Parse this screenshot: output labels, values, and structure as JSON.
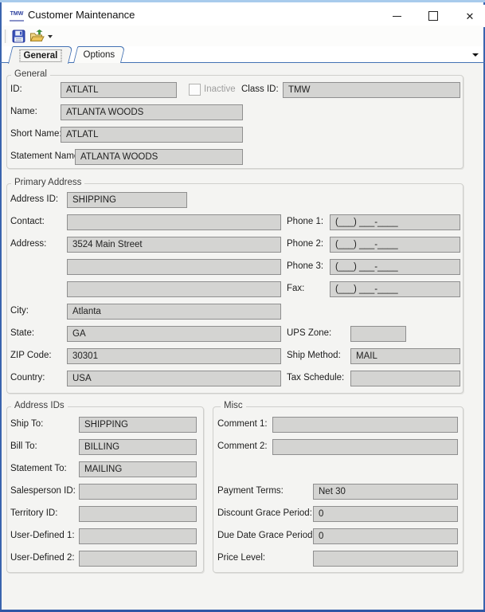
{
  "window": {
    "title": "Customer Maintenance",
    "app_icon_text": "TMW",
    "controls": {
      "minimize": "minimize",
      "maximize": "maximize",
      "close": "✕"
    }
  },
  "toolbar": {
    "save_icon": "floppy-disk",
    "open_icon": "folder-green-arrow",
    "overflow_caret": "▾"
  },
  "tab_bar": {
    "tabs": [
      {
        "label": "General",
        "selected": true
      },
      {
        "label": "Options",
        "selected": false
      }
    ],
    "overflow_caret": "▾"
  },
  "sections": {
    "general": {
      "legend": "General",
      "fields": {
        "id": {
          "label": "ID:",
          "value": "ATLATL"
        },
        "inactive": {
          "label": "Inactive",
          "checked": false
        },
        "class_id": {
          "label": "Class ID:",
          "value": "TMW"
        },
        "name": {
          "label": "Name:",
          "value": "ATLANTA WOODS"
        },
        "short_name": {
          "label": "Short Name:",
          "value": "ATLATL"
        },
        "statement_name": {
          "label": "Statement Name:",
          "value": "ATLANTA WOODS"
        }
      }
    },
    "primary_address": {
      "legend": "Primary Address",
      "fields": {
        "address_id": {
          "label": "Address ID:",
          "value": "SHIPPING"
        },
        "contact": {
          "label": "Contact:",
          "value": ""
        },
        "address1": {
          "label": "Address:",
          "value": "3524 Main Street"
        },
        "address2": {
          "label": "",
          "value": ""
        },
        "address3": {
          "label": "",
          "value": ""
        },
        "city": {
          "label": "City:",
          "value": "Atlanta"
        },
        "state": {
          "label": "State:",
          "value": "GA"
        },
        "zip": {
          "label": "ZIP Code:",
          "value": "30301"
        },
        "country": {
          "label": "Country:",
          "value": "USA"
        },
        "phone1": {
          "label": "Phone 1:",
          "value": "(___) ___-____"
        },
        "phone2": {
          "label": "Phone 2:",
          "value": "(___) ___-____"
        },
        "phone3": {
          "label": "Phone 3:",
          "value": "(___) ___-____"
        },
        "fax": {
          "label": "Fax:",
          "value": "(___) ___-____"
        },
        "ups_zone": {
          "label": "UPS Zone:",
          "value": ""
        },
        "ship_method": {
          "label": "Ship Method:",
          "value": "MAIL"
        },
        "tax_schedule": {
          "label": "Tax Schedule:",
          "value": ""
        }
      }
    },
    "address_ids": {
      "legend": "Address IDs",
      "fields": {
        "ship_to": {
          "label": "Ship To:",
          "value": "SHIPPING"
        },
        "bill_to": {
          "label": "Bill To:",
          "value": "BILLING"
        },
        "statement_to": {
          "label": "Statement To:",
          "value": "MAILING"
        },
        "salesperson_id": {
          "label": "Salesperson ID:",
          "value": ""
        },
        "territory_id": {
          "label": "Territory ID:",
          "value": ""
        },
        "user_defined_1": {
          "label": "User-Defined 1:",
          "value": ""
        },
        "user_defined_2": {
          "label": "User-Defined 2:",
          "value": ""
        }
      }
    },
    "misc": {
      "legend": "Misc",
      "fields": {
        "comment1": {
          "label": "Comment 1:",
          "value": ""
        },
        "comment2": {
          "label": "Comment 2:",
          "value": ""
        },
        "payment_terms": {
          "label": "Payment Terms:",
          "value": "Net 30"
        },
        "discount_grace_period": {
          "label": "Discount Grace Period:",
          "value": "0"
        },
        "due_date_grace_period": {
          "label": "Due Date Grace Period:",
          "value": "0"
        },
        "price_level": {
          "label": "Price Level:",
          "value": ""
        }
      }
    }
  },
  "colors": {
    "window_border": "#3a64ae",
    "window_border_top": "#a8cbec",
    "content_bg": "#f4f4f2",
    "field_bg": "#d4d4d2",
    "field_border": "#8f8f8f",
    "tab_border": "#4472b4",
    "disabled_text": "#9e9e9e"
  }
}
